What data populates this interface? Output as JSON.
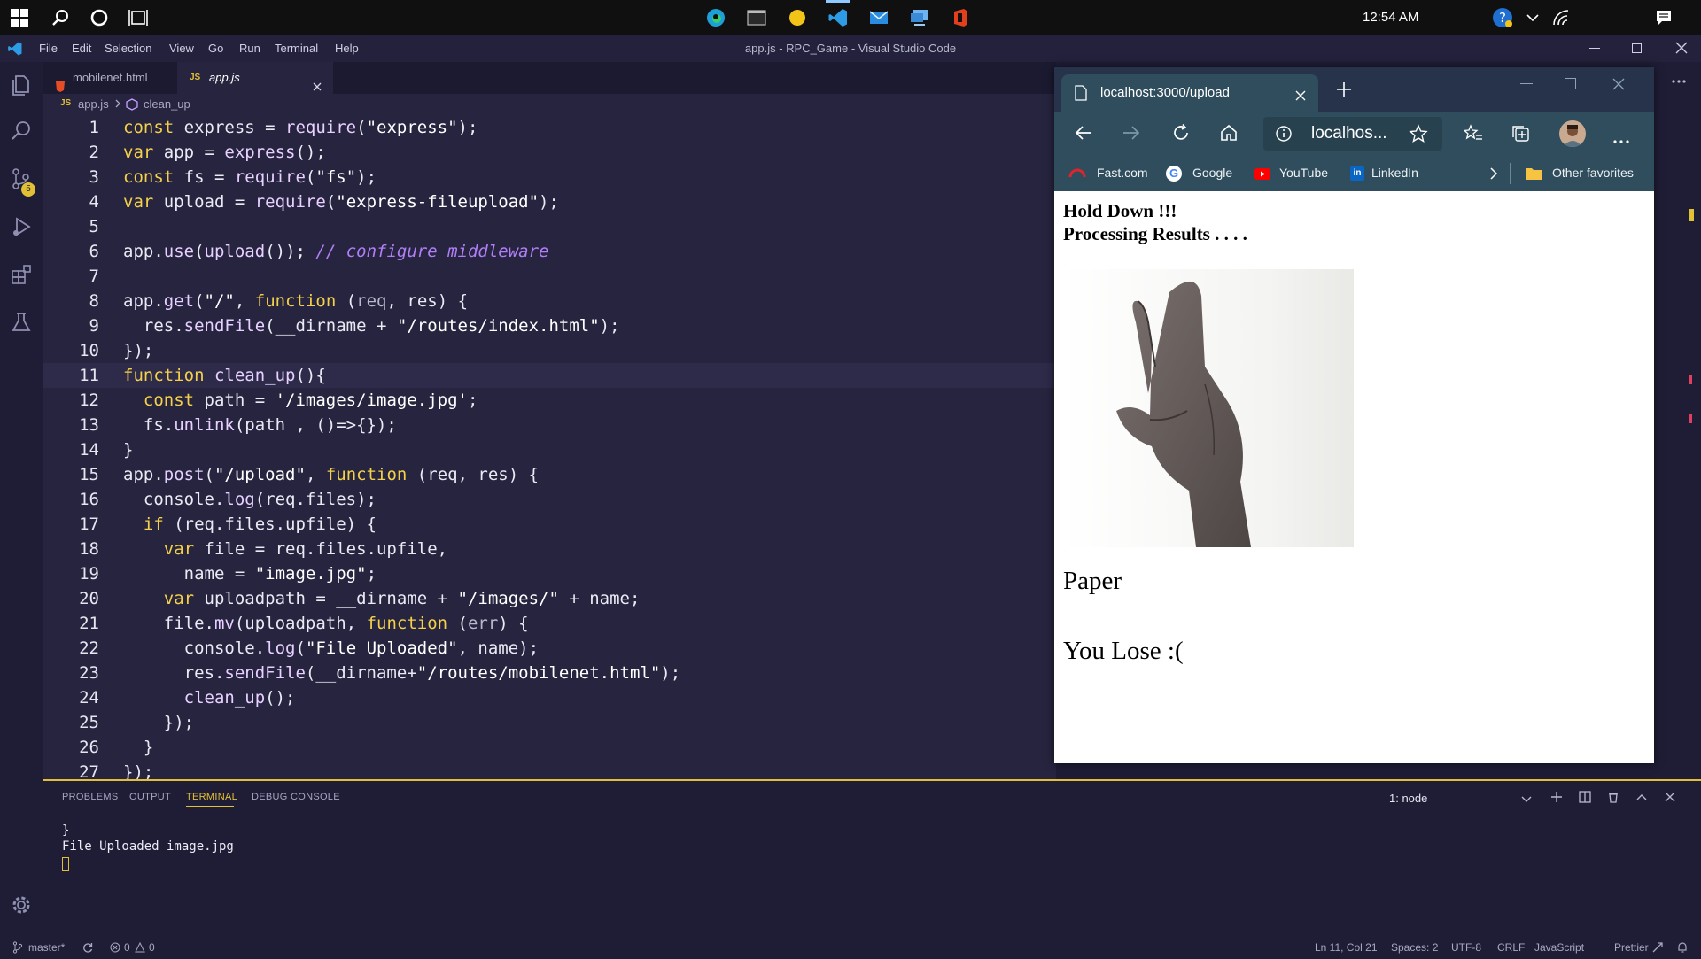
{
  "taskbar": {
    "clock": "12:54 AM"
  },
  "titlebar": {
    "menu": [
      "File",
      "Edit",
      "Selection",
      "View",
      "Go",
      "Run",
      "Terminal",
      "Help"
    ],
    "window_title": "app.js - RPC_Game - Visual Studio Code"
  },
  "activity": {
    "scm_badge": "5"
  },
  "tabs": [
    {
      "label": "mobilenet.html",
      "icon": "html-file-icon"
    },
    {
      "label": "app.js",
      "prefix": "JS",
      "icon": "js-file-icon"
    }
  ],
  "breadcrumb": {
    "prefix": "JS",
    "file": "app.js",
    "symbol": "clean_up"
  },
  "editor": {
    "line_numbers": [
      "1",
      "2",
      "3",
      "4",
      "5",
      "6",
      "7",
      "8",
      "9",
      "10",
      "11",
      "12",
      "13",
      "14",
      "15",
      "16",
      "17",
      "18",
      "19",
      "20",
      "21",
      "22",
      "23",
      "24",
      "25",
      "26",
      "27"
    ]
  },
  "panel": {
    "tabs": [
      "PROBLEMS",
      "OUTPUT",
      "TERMINAL",
      "DEBUG CONSOLE"
    ],
    "terminal_select": "1: node",
    "terminal_lines": [
      "}",
      "File Uploaded image.jpg"
    ]
  },
  "status": {
    "branch": "master*",
    "errors": "0",
    "warnings": "0",
    "position": "Ln 11, Col 21",
    "spaces": "Spaces: 2",
    "encoding": "UTF-8",
    "eol": "CRLF",
    "language": "JavaScript",
    "formatter": "Prettier"
  },
  "browser": {
    "tab_title": "localhost:3000/upload",
    "address": "localhos...",
    "favorites": [
      "Fast.com",
      "Google",
      "YouTube",
      "LinkedIn"
    ],
    "other_favorites": "Other favorites",
    "content": {
      "heading1": "Hold Down !!!",
      "heading2": "Processing Results . . . .",
      "result": "Paper",
      "outcome": "You Lose :("
    }
  },
  "colors": {
    "accent": "#e2c035",
    "editor_bg": "#26243f",
    "browser_chrome": "#2f4d5c"
  }
}
